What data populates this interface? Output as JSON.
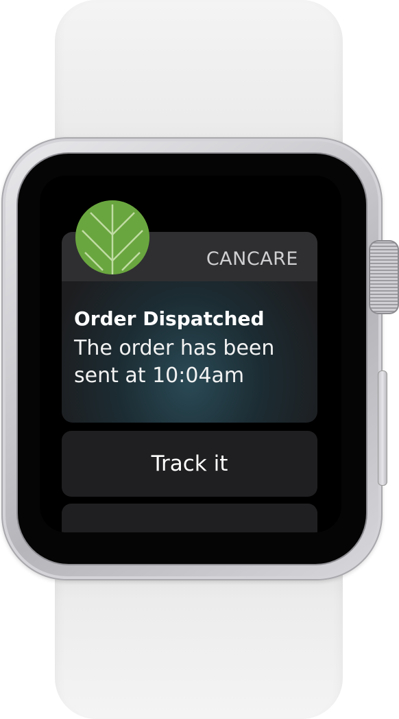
{
  "notification": {
    "app_name": "CANCARE",
    "title": "Order Dispatched",
    "body": "The order has been sent at 10:04am",
    "icon": "cancare-leaf-icon",
    "accent_color": "#6aa63f"
  },
  "actions": {
    "primary_label": "Track it"
  }
}
